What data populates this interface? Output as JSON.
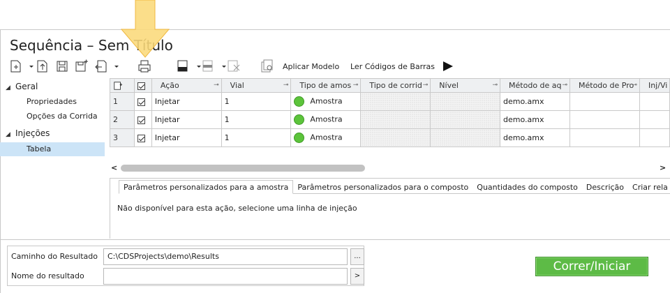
{
  "window": {
    "title": "Sequência – Sem Título"
  },
  "toolbar": {
    "apply_template_label": "Aplicar Modelo",
    "read_barcodes_label": "Ler Códigos de Barras"
  },
  "nav": {
    "groups": [
      {
        "label": "Geral",
        "items": [
          "Propriedades",
          "Opções da Corrida"
        ]
      },
      {
        "label": "Injeções",
        "items": [
          "Tabela"
        ]
      }
    ],
    "selected": "Tabela"
  },
  "grid": {
    "columns": [
      "Ação",
      "Vial",
      "Tipo de amos",
      "Tipo de corrid",
      "Nível",
      "Método de aq",
      "Método de Pro",
      "Inj/Vi"
    ],
    "rows": [
      {
        "n": "1",
        "action": "Injetar",
        "vial": "1",
        "sample_type": "Amostra",
        "method": "demo.amx"
      },
      {
        "n": "2",
        "action": "Injetar",
        "vial": "1",
        "sample_type": "Amostra",
        "method": "demo.amx"
      },
      {
        "n": "3",
        "action": "Injetar",
        "vial": "1",
        "sample_type": "Amostra",
        "method": "demo.amx"
      }
    ]
  },
  "tabs": [
    "Parâmetros personalizados para a amostra",
    "Parâmetros personalizados para o composto",
    "Quantidades do composto",
    "Descrição",
    "Criar rela"
  ],
  "panel": {
    "message": "Não disponível para esta ação, selecione uma linha de injeção"
  },
  "result": {
    "path_label": "Caminho do Resultado",
    "path_value": "C:\\CDSProjects\\demo\\Results",
    "path_button": "...",
    "name_label": "Nome do resultado",
    "name_value": "",
    "name_button": ">"
  },
  "run_button": "Correr/Iniciar",
  "colors": {
    "accent_green": "#5dbb46",
    "selection": "#cce4f7",
    "callout": "#fbd97a",
    "status_dot": "#5cc43b"
  }
}
